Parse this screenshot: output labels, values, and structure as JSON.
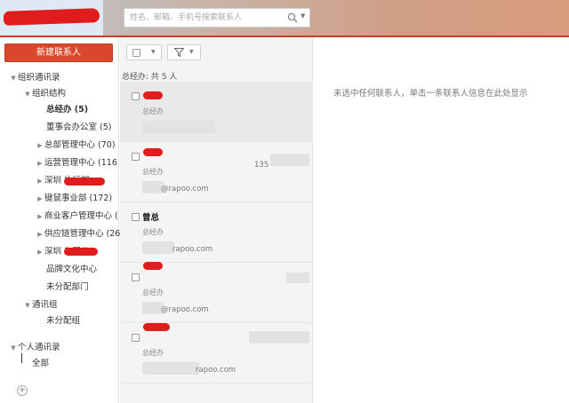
{
  "header": {
    "search_placeholder": "姓名、邮箱、手机号搜索联系人"
  },
  "sidebar": {
    "new_contact_label": "新建联系人",
    "tree": [
      {
        "label": "组织通讯录",
        "arrow": "▼"
      },
      {
        "label": "组织结构",
        "arrow": "▼"
      },
      {
        "label": "总经办 (5)",
        "arrow": ""
      },
      {
        "label": "董事会办公室 (5)",
        "arrow": ""
      },
      {
        "label": "总部管理中心 (70)",
        "arrow": "▶"
      },
      {
        "label": "运营管理中心 (116",
        "arrow": "▶"
      },
      {
        "label": "深圳                   执行部",
        "arrow": "▶"
      },
      {
        "label": "键鼠事业部 (172)",
        "arrow": "▶"
      },
      {
        "label": "商业客户管理中心 (",
        "arrow": "▶"
      },
      {
        "label": "供应链管理中心 (26",
        "arrow": "▶"
      },
      {
        "label": "深圳                有限公",
        "arrow": "▶"
      },
      {
        "label": "品牌文化中心",
        "arrow": ""
      },
      {
        "label": "未分配部门",
        "arrow": ""
      },
      {
        "label": "通讯组",
        "arrow": "▼"
      },
      {
        "label": "未分配组",
        "arrow": ""
      },
      {
        "label": "个人通讯录",
        "arrow": "▼"
      },
      {
        "label": "全部",
        "arrow": ""
      }
    ]
  },
  "list": {
    "count_label": "总经办: 共 5 人",
    "contacts": [
      {
        "name": "",
        "dept": "总经办",
        "email": "",
        "phone": ""
      },
      {
        "name": "",
        "dept": "总经办",
        "email": "@rapoo.com",
        "phone": "135"
      },
      {
        "name": "曾总",
        "dept": "总经办",
        "email": "rapoo.com",
        "phone": ""
      },
      {
        "name": "",
        "dept": "总经办",
        "email": "@rapoo.com",
        "phone": ""
      },
      {
        "name": "",
        "dept": "总经办",
        "email": "rapoo.com",
        "phone": ""
      }
    ]
  },
  "detail": {
    "empty_message": "未选中任何联系人，单击一条联系人信息在此处显示"
  },
  "colors": {
    "accent": "#d9482c",
    "header_line": "#d23b2a",
    "redaction": "#e01c1c"
  }
}
